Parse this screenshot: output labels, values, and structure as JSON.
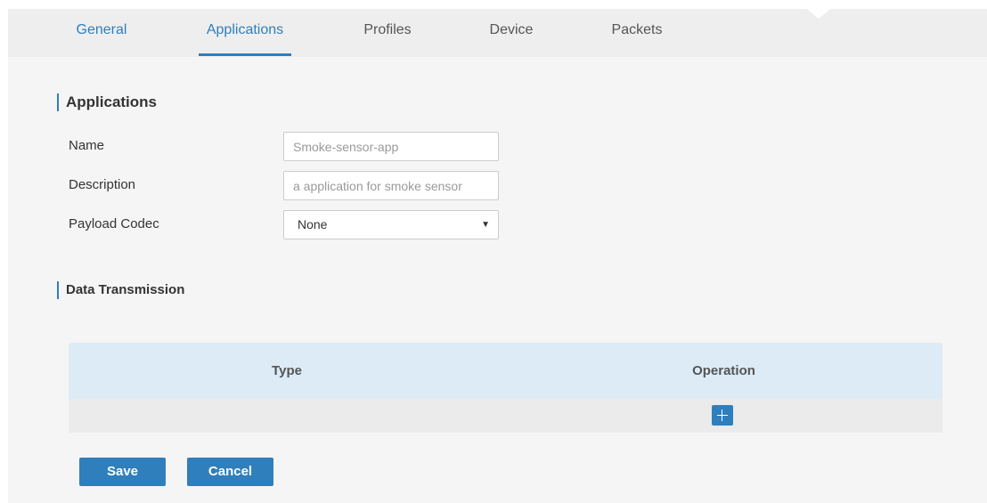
{
  "tabs": [
    {
      "label": "General"
    },
    {
      "label": "Applications",
      "active": true
    },
    {
      "label": "Profiles"
    },
    {
      "label": "Device"
    },
    {
      "label": "Packets"
    }
  ],
  "applications_section": {
    "title": "Applications",
    "fields": {
      "name": {
        "label": "Name",
        "placeholder": "Smoke-sensor-app"
      },
      "description": {
        "label": "Description",
        "placeholder": "a application for smoke sensor"
      },
      "payload_codec": {
        "label": "Payload Codec",
        "value": "None"
      }
    }
  },
  "data_transmission": {
    "title": "Data Transmission",
    "columns": [
      "Type",
      "Operation"
    ],
    "add_icon": "plus-icon"
  },
  "actions": {
    "save": "Save",
    "cancel": "Cancel"
  },
  "colors": {
    "accent": "#2f7fbd",
    "table_header": "#dcebf5",
    "background": "#f5f5f5"
  }
}
